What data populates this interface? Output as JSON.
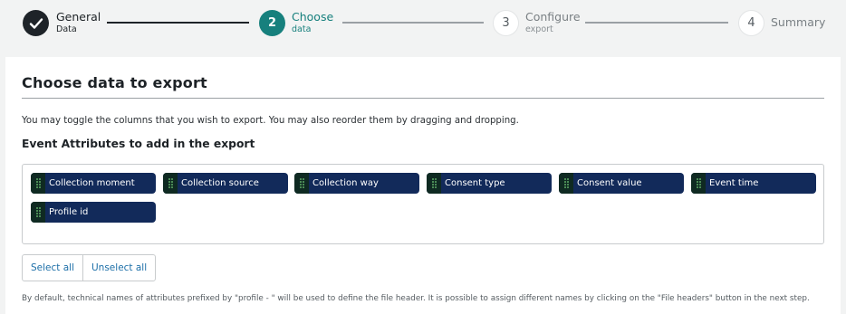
{
  "stepper": {
    "steps": [
      {
        "number": "",
        "title": "General",
        "subtitle": "Data",
        "state": "done"
      },
      {
        "number": "2",
        "title": "Choose",
        "subtitle": "data",
        "state": "active"
      },
      {
        "number": "3",
        "title": "Configure",
        "subtitle": "export",
        "state": "pending"
      },
      {
        "number": "4",
        "title": "Summary",
        "subtitle": "",
        "state": "pending"
      }
    ],
    "colors": {
      "done": "#1e2328",
      "active": "#17807d",
      "pending": "#9aa0a4"
    }
  },
  "panel": {
    "title": "Choose data to export",
    "description": "You may toggle the columns that you wish to export. You may also reorder them by dragging and dropping.",
    "section_title": "Event Attributes to add in the export",
    "attributes": [
      "Collection moment",
      "Collection source",
      "Collection way",
      "Consent type",
      "Consent value",
      "Event time",
      "Profile id"
    ],
    "chip_color": "#122a5a",
    "buttons": {
      "select_all": "Select all",
      "unselect_all": "Unselect all"
    },
    "footnote": "By default, technical names of attributes prefixed by \"profile - \" will be used to define the file header. It is possible to assign different names by clicking on the \"File headers\" button in the next step."
  }
}
